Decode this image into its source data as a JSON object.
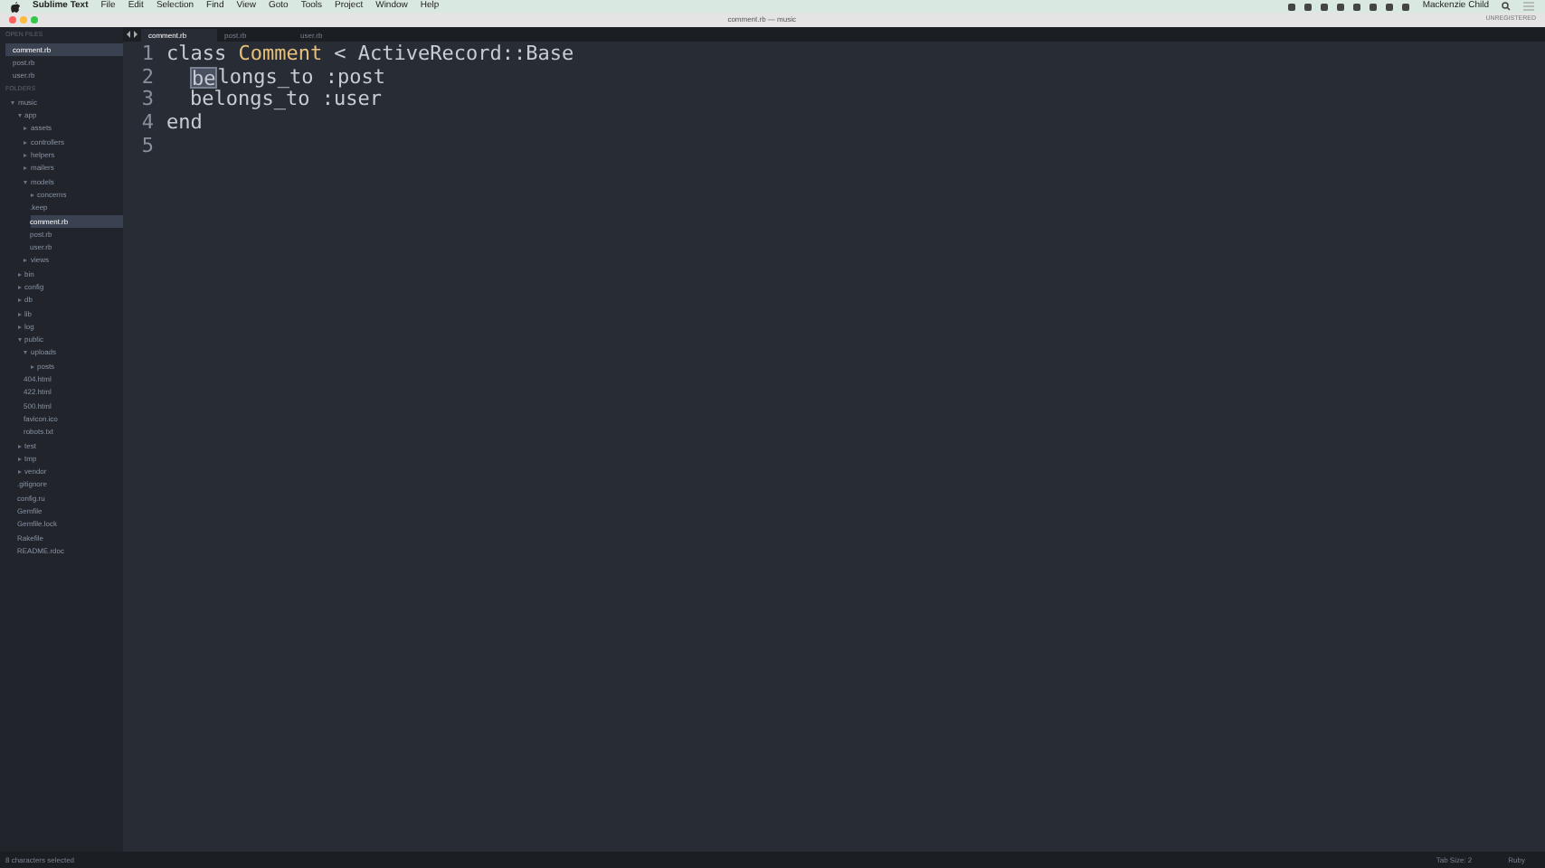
{
  "menu_bar": {
    "app_name": "Sublime Text",
    "items": [
      "File",
      "Edit",
      "Selection",
      "Find",
      "View",
      "Goto",
      "Tools",
      "Project",
      "Window",
      "Help"
    ],
    "user": "Mackenzie Child"
  },
  "window": {
    "title": "comment.rb — music",
    "license": "UNREGISTERED"
  },
  "sidebar": {
    "open_files_label": "OPEN FILES",
    "open_files": [
      {
        "name": "comment.rb",
        "selected": true
      },
      {
        "name": "post.rb",
        "selected": false
      },
      {
        "name": "user.rb",
        "selected": false
      }
    ],
    "folders_label": "FOLDERS",
    "tree": [
      {
        "name": "music",
        "kind": "folder",
        "expanded": true,
        "selected": false,
        "children": [
          {
            "name": "app",
            "kind": "folder",
            "expanded": true,
            "selected": false,
            "children": [
              {
                "name": "assets",
                "kind": "folder",
                "expanded": false,
                "selected": false
              },
              {
                "name": "controllers",
                "kind": "folder",
                "expanded": false,
                "selected": false
              },
              {
                "name": "helpers",
                "kind": "folder",
                "expanded": false,
                "selected": false
              },
              {
                "name": "mailers",
                "kind": "folder",
                "expanded": false,
                "selected": false
              },
              {
                "name": "models",
                "kind": "folder",
                "expanded": true,
                "selected": false,
                "children": [
                  {
                    "name": "concerns",
                    "kind": "folder",
                    "expanded": false,
                    "selected": false
                  },
                  {
                    "name": ".keep",
                    "kind": "file",
                    "selected": false
                  },
                  {
                    "name": "comment.rb",
                    "kind": "file",
                    "selected": true
                  },
                  {
                    "name": "post.rb",
                    "kind": "file",
                    "selected": false
                  },
                  {
                    "name": "user.rb",
                    "kind": "file",
                    "selected": false
                  }
                ]
              },
              {
                "name": "views",
                "kind": "folder",
                "expanded": false,
                "selected": false
              }
            ]
          },
          {
            "name": "bin",
            "kind": "folder",
            "expanded": false,
            "selected": false
          },
          {
            "name": "config",
            "kind": "folder",
            "expanded": false,
            "selected": false
          },
          {
            "name": "db",
            "kind": "folder",
            "expanded": false,
            "selected": false
          },
          {
            "name": "lib",
            "kind": "folder",
            "expanded": false,
            "selected": false
          },
          {
            "name": "log",
            "kind": "folder",
            "expanded": false,
            "selected": false
          },
          {
            "name": "public",
            "kind": "folder",
            "expanded": true,
            "selected": false,
            "children": [
              {
                "name": "uploads",
                "kind": "folder",
                "expanded": true,
                "selected": false,
                "children": [
                  {
                    "name": "posts",
                    "kind": "folder",
                    "expanded": false,
                    "selected": false
                  }
                ]
              },
              {
                "name": "404.html",
                "kind": "file",
                "selected": false
              },
              {
                "name": "422.html",
                "kind": "file",
                "selected": false
              },
              {
                "name": "500.html",
                "kind": "file",
                "selected": false
              },
              {
                "name": "favicon.ico",
                "kind": "file",
                "selected": false
              },
              {
                "name": "robots.txt",
                "kind": "file",
                "selected": false
              }
            ]
          },
          {
            "name": "test",
            "kind": "folder",
            "expanded": false,
            "selected": false
          },
          {
            "name": "tmp",
            "kind": "folder",
            "expanded": false,
            "selected": false
          },
          {
            "name": "vendor",
            "kind": "folder",
            "expanded": false,
            "selected": false
          },
          {
            "name": ".gitignore",
            "kind": "file",
            "selected": false
          },
          {
            "name": "config.ru",
            "kind": "file",
            "selected": false
          },
          {
            "name": "Gemfile",
            "kind": "file",
            "selected": false
          },
          {
            "name": "Gemfile.lock",
            "kind": "file",
            "selected": false
          },
          {
            "name": "Rakefile",
            "kind": "file",
            "selected": false
          },
          {
            "name": "README.rdoc",
            "kind": "file",
            "selected": false
          }
        ]
      }
    ]
  },
  "tabs": [
    {
      "label": "comment.rb",
      "selected": true
    },
    {
      "label": "post.rb",
      "selected": false
    },
    {
      "label": "user.rb",
      "selected": false
    }
  ],
  "editor": {
    "lines": [
      {
        "number": "1",
        "indented": false,
        "tokens": [
          {
            "text": "class",
            "kind": "keyword"
          },
          {
            "text": "Comment",
            "kind": "class"
          },
          {
            "text": "< ActiveRecord::Base",
            "kind": "plain"
          }
        ]
      },
      {
        "number": "2",
        "indented": true,
        "tokens": [
          {
            "text": "be",
            "kind": "selected"
          },
          {
            "text": "longs_to :post",
            "kind": "joined"
          }
        ]
      },
      {
        "number": "3",
        "indented": true,
        "tokens": [
          {
            "text": "belongs_to :user",
            "kind": "plain"
          }
        ]
      },
      {
        "number": "4",
        "indented": false,
        "tokens": [
          {
            "text": "end",
            "kind": "keyword"
          }
        ]
      },
      {
        "number": "5",
        "indented": false
      }
    ]
  },
  "status_bar": {
    "message": "8 characters selected",
    "tab_size": "Tab Size: 2",
    "syntax": "Ruby"
  }
}
